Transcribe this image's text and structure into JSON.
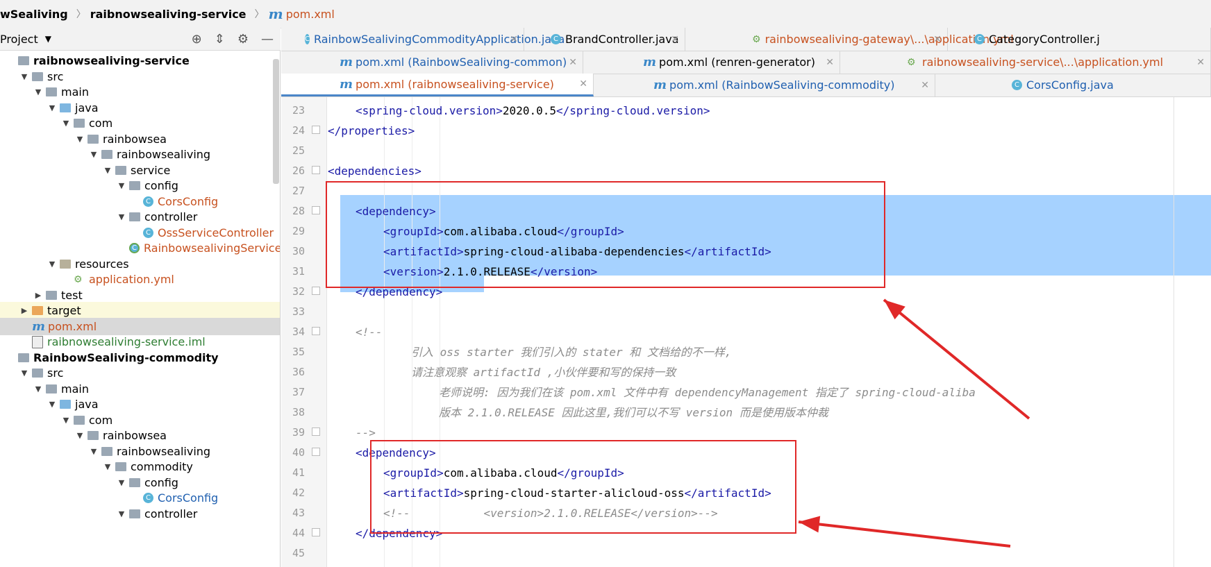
{
  "breadcrumb": {
    "project": "wSealiving",
    "module": "raibnowsealiving-service",
    "file_icon": "m",
    "file": "pom.xml"
  },
  "project_panel": {
    "title": "Project",
    "tools": [
      "target-icon",
      "collapse-icon",
      "gear-icon",
      "minimize-icon"
    ]
  },
  "tree": [
    {
      "label": "raibnowsealiving-service",
      "depth": 0,
      "icon": "module-folder-icon",
      "arrow": "",
      "style": "bold"
    },
    {
      "label": "src",
      "depth": 1,
      "icon": "folder-icon",
      "arrow": "▼"
    },
    {
      "label": "main",
      "depth": 2,
      "icon": "folder-icon",
      "arrow": "▼"
    },
    {
      "label": "java",
      "depth": 3,
      "icon": "source-folder-icon",
      "arrow": "▼"
    },
    {
      "label": "com",
      "depth": 4,
      "icon": "package-icon",
      "arrow": "▼"
    },
    {
      "label": "rainbowsea",
      "depth": 5,
      "icon": "package-icon",
      "arrow": "▼"
    },
    {
      "label": "rainbowsealiving",
      "depth": 6,
      "icon": "package-icon",
      "arrow": "▼"
    },
    {
      "label": "service",
      "depth": 7,
      "icon": "package-icon",
      "arrow": "▼"
    },
    {
      "label": "config",
      "depth": 8,
      "icon": "package-icon",
      "arrow": "▼"
    },
    {
      "label": "CorsConfig",
      "depth": 9,
      "icon": "class-icon",
      "arrow": "",
      "style": "orange"
    },
    {
      "label": "controller",
      "depth": 8,
      "icon": "package-icon",
      "arrow": "▼"
    },
    {
      "label": "OssServiceController",
      "depth": 9,
      "icon": "class-icon",
      "arrow": "",
      "style": "orange"
    },
    {
      "label": "RainbowsealivingServiceAp",
      "depth": 8,
      "icon": "spring-class-icon",
      "arrow": "",
      "style": "orange"
    },
    {
      "label": "resources",
      "depth": 3,
      "icon": "resources-folder-icon",
      "arrow": "▼"
    },
    {
      "label": "application.yml",
      "depth": 4,
      "icon": "yml-icon",
      "arrow": "",
      "style": "orange"
    },
    {
      "label": "test",
      "depth": 2,
      "icon": "folder-icon",
      "arrow": "▶"
    },
    {
      "label": "target",
      "depth": 1,
      "icon": "target-folder-icon",
      "arrow": "▶",
      "style": "hl"
    },
    {
      "label": "pom.xml",
      "depth": 1,
      "icon": "maven-icon",
      "arrow": "",
      "style": "orange",
      "selected": true
    },
    {
      "label": "raibnowsealiving-service.iml",
      "depth": 1,
      "icon": "iml-icon",
      "arrow": "",
      "style": "green"
    },
    {
      "label": "RainbowSealiving-commodity",
      "depth": 0,
      "icon": "module-folder-icon",
      "arrow": "",
      "style": "bold"
    },
    {
      "label": "src",
      "depth": 1,
      "icon": "folder-icon",
      "arrow": "▼"
    },
    {
      "label": "main",
      "depth": 2,
      "icon": "folder-icon",
      "arrow": "▼"
    },
    {
      "label": "java",
      "depth": 3,
      "icon": "source-folder-icon",
      "arrow": "▼"
    },
    {
      "label": "com",
      "depth": 4,
      "icon": "package-icon",
      "arrow": "▼"
    },
    {
      "label": "rainbowsea",
      "depth": 5,
      "icon": "package-icon",
      "arrow": "▼"
    },
    {
      "label": "rainbowsealiving",
      "depth": 6,
      "icon": "package-icon",
      "arrow": "▼"
    },
    {
      "label": "commodity",
      "depth": 7,
      "icon": "package-icon",
      "arrow": "▼"
    },
    {
      "label": "config",
      "depth": 8,
      "icon": "package-icon",
      "arrow": "▼"
    },
    {
      "label": "CorsConfig",
      "depth": 9,
      "icon": "class-icon",
      "arrow": "",
      "style": "blue"
    },
    {
      "label": "controller",
      "depth": 8,
      "icon": "package-icon",
      "arrow": "▼"
    }
  ],
  "tabs": [
    [
      {
        "label": "RainbowSealivingCommodityApplication.java",
        "icon": "spring-class-icon",
        "color": "blue"
      },
      {
        "label": "BrandController.java",
        "icon": "class-icon",
        "color": "black"
      },
      {
        "label": "rainbowsealiving-gateway\\...\\application.yml",
        "icon": "yml-icon",
        "color": "orange"
      },
      {
        "label": "CategoryController.j",
        "icon": "class-icon",
        "color": "black"
      }
    ],
    [
      {
        "label": "pom.xml (RainbowSealiving-common)",
        "icon": "maven-icon",
        "color": "blue"
      },
      {
        "label": "pom.xml (renren-generator)",
        "icon": "maven-icon",
        "color": "black"
      },
      {
        "label": "raibnowsealiving-service\\...\\application.yml",
        "icon": "yml-icon",
        "color": "orange"
      }
    ],
    [
      {
        "label": "pom.xml (raibnowsealiving-service)",
        "icon": "maven-icon",
        "color": "orange",
        "active": true
      },
      {
        "label": "pom.xml (RainbowSealiving-commodity)",
        "icon": "maven-icon",
        "color": "blue"
      },
      {
        "label": "CorsConfig.java",
        "icon": "class-icon",
        "color": "blue"
      }
    ]
  ],
  "editor": {
    "lines": [
      {
        "n": "23",
        "indent": 1,
        "open": "<spring-cloud.version>",
        "text": "2020.0.5",
        "close": "</spring-cloud.version>"
      },
      {
        "n": "24",
        "indent": 0,
        "open": "</properties>",
        "text": "",
        "close": ""
      },
      {
        "n": "25",
        "indent": 0,
        "open": "",
        "text": "",
        "close": ""
      },
      {
        "n": "26",
        "indent": 0,
        "open": "<dependencies>",
        "text": "",
        "close": ""
      },
      {
        "n": "27",
        "indent": 0,
        "open": "",
        "text": "",
        "close": ""
      },
      {
        "n": "28",
        "indent": 1,
        "open": "<dependency>",
        "text": "",
        "close": ""
      },
      {
        "n": "29",
        "indent": 2,
        "open": "<groupId>",
        "text": "com.alibaba.cloud",
        "close": "</groupId>"
      },
      {
        "n": "30",
        "indent": 2,
        "open": "<artifactId>",
        "text": "spring-cloud-alibaba-dependencies",
        "close": "</artifactId>"
      },
      {
        "n": "31",
        "indent": 2,
        "open": "<version>",
        "text": "2.1.0.RELEASE",
        "close": "</version>"
      },
      {
        "n": "32",
        "indent": 1,
        "open": "</dependency>",
        "text": "",
        "close": ""
      },
      {
        "n": "33",
        "indent": 0,
        "open": "",
        "text": "",
        "close": ""
      },
      {
        "n": "34",
        "indent": 1,
        "comment": "<!--"
      },
      {
        "n": "35",
        "indent": 3,
        "comment": "引入 oss starter 我们引入的 stater 和 文档给的不一样,"
      },
      {
        "n": "36",
        "indent": 3,
        "comment": "请注意观察 artifactId ,小伙伴要和写的保持一致"
      },
      {
        "n": "37",
        "indent": 4,
        "comment": "老师说明: 因为我们在该 pom.xml 文件中有 dependencyManagement 指定了 spring-cloud-aliba"
      },
      {
        "n": "38",
        "indent": 4,
        "comment": "版本 2.1.0.RELEASE 因此这里,我们可以不写 version 而是使用版本仲裁"
      },
      {
        "n": "39",
        "indent": 1,
        "comment": "-->"
      },
      {
        "n": "40",
        "indent": 1,
        "open": "<dependency>",
        "text": "",
        "close": ""
      },
      {
        "n": "41",
        "indent": 2,
        "open": "<groupId>",
        "text": "com.alibaba.cloud",
        "close": "</groupId>"
      },
      {
        "n": "42",
        "indent": 2,
        "open": "<artifactId>",
        "text": "spring-cloud-starter-alicloud-oss",
        "close": "</artifactId>"
      },
      {
        "n": "43",
        "indent": 2,
        "comment": "<!--           <version>2.1.0.RELEASE</version>-->"
      },
      {
        "n": "44",
        "indent": 1,
        "open": "</dependency>",
        "text": "",
        "close": ""
      },
      {
        "n": "45",
        "indent": 0,
        "open": "",
        "text": "",
        "close": ""
      }
    ]
  },
  "colors": {
    "accent": "#4a86c8",
    "selection": "#a6d2ff",
    "annotation": "#e02828",
    "xml_tag": "#1a1aa6",
    "comment": "#8c8c8c",
    "orange_text": "#c7511f"
  }
}
